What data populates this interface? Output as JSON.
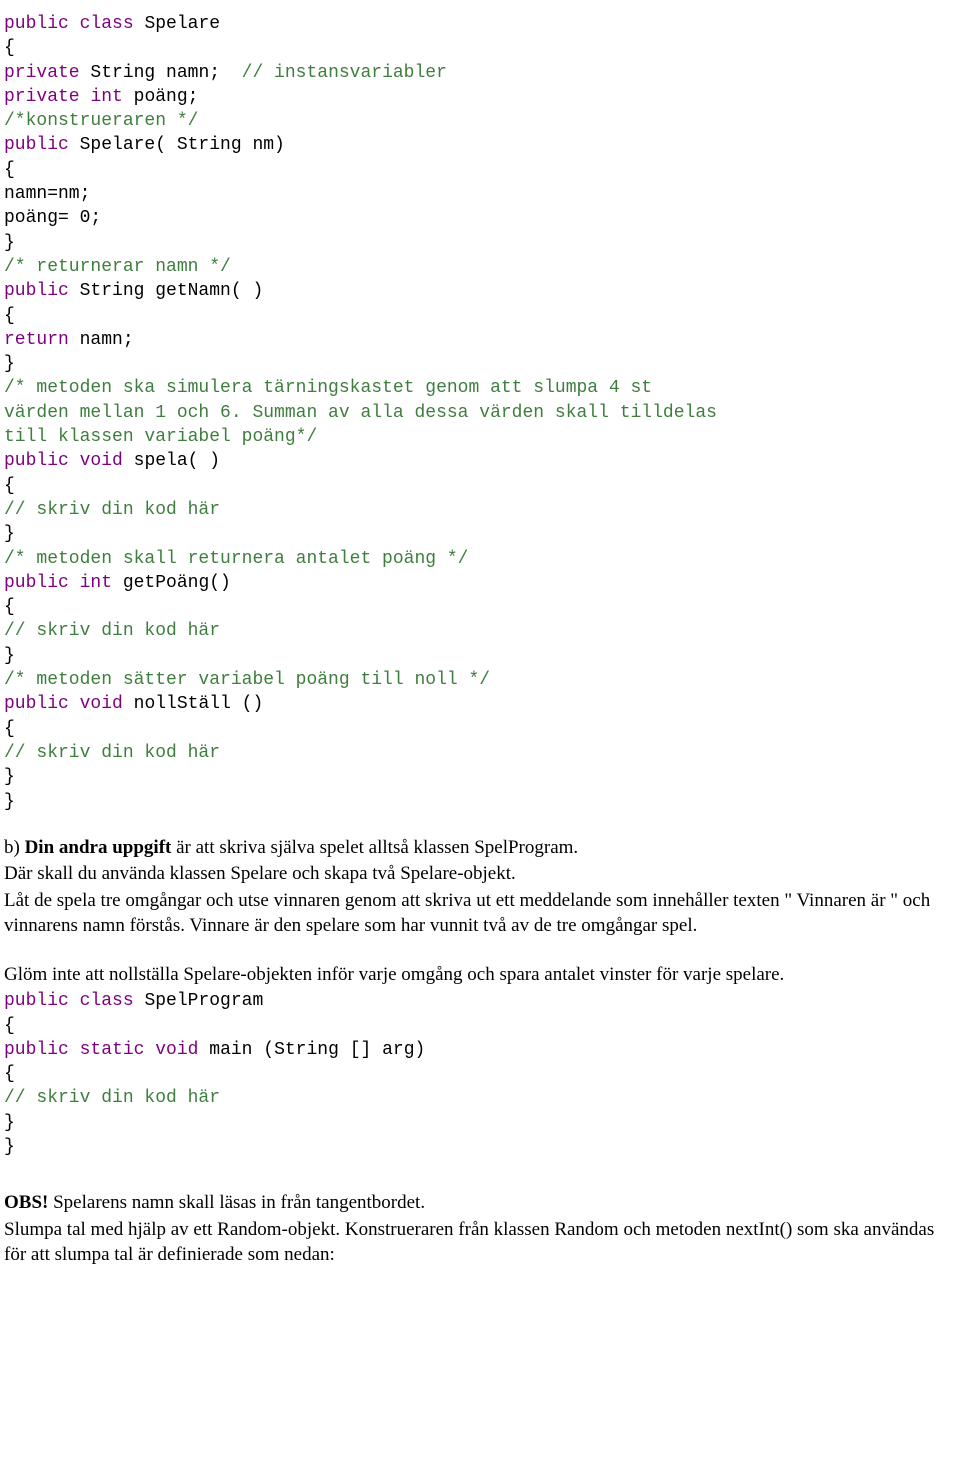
{
  "colors": {
    "keyword": "#7f007f",
    "comment": "#3e7e3e",
    "text": "#000000"
  },
  "code1": {
    "l01_kw1": "public",
    "l01_kw2": "class",
    "l01_name": " Spelare",
    "l02": "{",
    "l03_kw1": "private",
    "l03_txt1": " String namn;  ",
    "l03_cm": "// instansvariabler",
    "l04_kw1": "private",
    "l04_kw2": "int",
    "l04_txt": " poäng;",
    "l05_cm": "/*konstrueraren */",
    "l06_kw": "public",
    "l06_txt": " Spelare( String nm)",
    "l07": "{",
    "l08": "namn=nm;",
    "l09": "poäng= 0;",
    "l10": "}",
    "l11_cm": "/* returnerar namn */",
    "l12_kw": "public",
    "l12_txt": " String getNamn( )",
    "l13": "{",
    "l14_kw": "return",
    "l14_txt": " namn;",
    "l15": "}",
    "l16_cm": "/* metoden ska simulera tärningskastet genom att slumpa 4 st\nvärden mellan 1 och 6. Summan av alla dessa värden skall tilldelas\ntill klassen variabel poäng*/",
    "l17_kw1": "public",
    "l17_kw2": "void",
    "l17_txt": " spela( )",
    "l18": "{",
    "l19_cm": "// skriv din kod här",
    "l20": "}",
    "l21_cm": "/* metoden skall returnera antalet poäng */",
    "l22_kw1": "public",
    "l22_kw2": "int",
    "l22_txt": " getPoäng()",
    "l23": "{",
    "l24_cm": "// skriv din kod här",
    "l25": "}",
    "l26_cm": "/* metoden sätter variabel poäng till noll */",
    "l27_kw1": "public",
    "l27_kw2": "void",
    "l27_txt": " nollStäll ()",
    "l28": "{",
    "l29_cm": "// skriv din kod här",
    "l30": "}",
    "l31": "}"
  },
  "body": {
    "p1_prefix": "b) ",
    "p1_bold": "Din andra uppgift",
    "p1_rest": " är att skriva själva spelet alltså klassen SpelProgram.",
    "p2": "Där skall du använda klassen Spelare och skapa två Spelare-objekt.",
    "p3": "Låt de spela tre omgångar och utse vinnaren genom att skriva ut ett meddelande som innehåller texten \" Vinnaren är \" och vinnarens namn förstås. Vinnare är den spelare som har vunnit två av de tre omgångar spel.",
    "p4": "Glöm inte att nollställa Spelare-objekten inför varje omgång och spara antalet vinster för varje spelare."
  },
  "code2": {
    "l01_kw1": "public",
    "l01_kw2": "class",
    "l01_name": " SpelProgram",
    "l02": "{",
    "l03_kw1": "public",
    "l03_kw2": "static",
    "l03_kw3": "void",
    "l03_txt": " main (String [] arg)",
    "l04": "{",
    "l05_cm": "// skriv din kod här",
    "l06": "}",
    "l07": "}"
  },
  "footer": {
    "obs_bold": "OBS!",
    "obs_rest": " Spelarens namn skall läsas in från tangentbordet.",
    "p2": "Slumpa tal med hjälp av ett Random-objekt. Konstrueraren från klassen Random och metoden nextInt() som ska användas för att slumpa tal är definierade som nedan:"
  }
}
